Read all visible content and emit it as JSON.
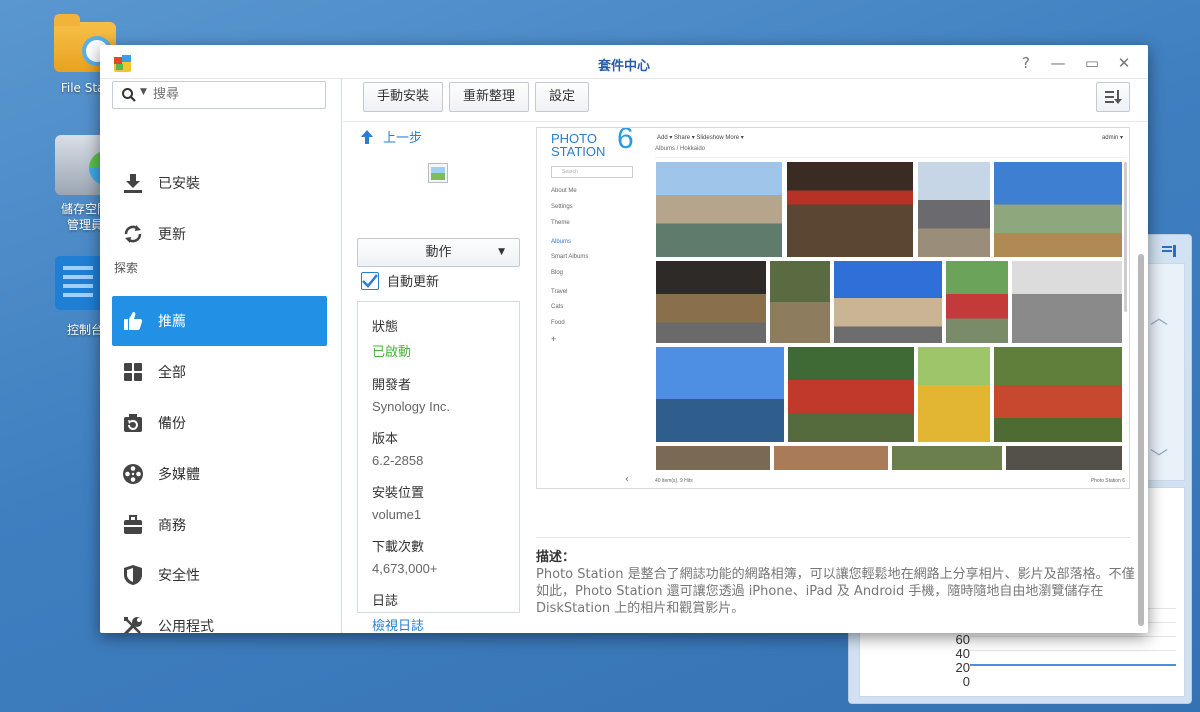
{
  "desktop": {
    "icons": [
      {
        "label": "File Stat"
      },
      {
        "label_line1": "儲存空間",
        "label_line2": "管理員"
      },
      {
        "label": "控制台"
      }
    ],
    "widget_chart": {
      "y_ticks": [
        "60",
        "40",
        "20",
        "0"
      ]
    }
  },
  "window": {
    "title": "套件中心",
    "controls": {
      "help": "?",
      "minimize": "—",
      "maximize": "▭",
      "close": "✕"
    }
  },
  "sidebar": {
    "search_placeholder": "搜尋",
    "items": [
      {
        "label": "已安裝",
        "icon": "download-icon"
      },
      {
        "label": "更新",
        "icon": "refresh-icon"
      }
    ],
    "section_label": "探索",
    "explore_items": [
      {
        "label": "推薦",
        "icon": "thumbs-up-icon",
        "active": true
      },
      {
        "label": "全部",
        "icon": "grid-icon"
      },
      {
        "label": "備份",
        "icon": "backup-icon"
      },
      {
        "label": "多媒體",
        "icon": "film-reel-icon"
      },
      {
        "label": "商務",
        "icon": "briefcase-icon"
      },
      {
        "label": "安全性",
        "icon": "shield-icon"
      },
      {
        "label": "公用程式",
        "icon": "tools-icon"
      }
    ]
  },
  "toolbar": {
    "manual_install": "手動安裝",
    "refresh": "重新整理",
    "settings": "設定"
  },
  "detail": {
    "back_label": "上一步",
    "action_label": "動作",
    "auto_update_label": "自動更新",
    "auto_update_checked": true,
    "info": [
      {
        "key": "狀態",
        "value": "已啟動",
        "style": "green"
      },
      {
        "key": "開發者",
        "value": "Synology Inc.",
        "style": ""
      },
      {
        "key": "版本",
        "value": "6.2-2858",
        "style": ""
      },
      {
        "key": "安裝位置",
        "value": "volume1",
        "style": ""
      },
      {
        "key": "下載次數",
        "value": "4,673,000+",
        "style": ""
      },
      {
        "key": "日誌",
        "value": "檢視日誌",
        "style": "link"
      }
    ],
    "screenshot": {
      "logo_line1": "PHOTO",
      "logo_line2": "STATION",
      "logo_number": "6",
      "top_menu": "Add ▾    Share ▾    Slideshow    More ▾",
      "user": "admin ▾",
      "breadcrumb": "Albums  /  Hokkaido",
      "search": "Search",
      "nav": [
        "About Me",
        "Settings",
        "Theme",
        "Albums",
        "Smart Albums",
        "Blog",
        "Travel",
        "Cats",
        "Food",
        "+"
      ],
      "footer_left": "40 item(s), 9 Hits",
      "footer_right": "Photo Station 6"
    },
    "description_title": "描述：",
    "description_body": "Photo Station 是整合了網誌功能的網路相簿，可以讓您輕鬆地在網路上分享相片、影片及部落格。不僅如此，Photo Station 還可讓您透過 iPhone、iPad 及 Android 手機，隨時隨地自由地瀏覽儲存在 DiskStation 上的相片和觀賞影片。"
  }
}
